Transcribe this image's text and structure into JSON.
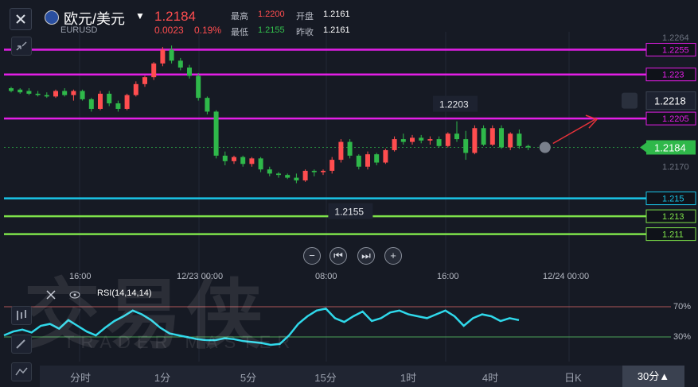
{
  "header": {
    "symbol_cn": "欧元/美元",
    "symbol_code": "EURUSD",
    "price": "1.2184",
    "change": "0.0023",
    "change_pct": "0.19%",
    "high_label": "最高",
    "high_value": "1.2200",
    "open_label": "开盘",
    "open_value": "1.2161",
    "low_label": "最低",
    "low_value": "1.2155",
    "prev_close_label": "昨收",
    "prev_close_value": "1.2161"
  },
  "price_axis": {
    "ticks": [
      {
        "text": "1.2264",
        "v": 1.2264
      },
      {
        "text": "1.2255",
        "v": 1.2255
      },
      {
        "text": "1.223",
        "v": 1.2237
      },
      {
        "text": "1.2218",
        "v": 1.2218
      },
      {
        "text": "1.2205",
        "v": 1.2205
      },
      {
        "text": "1.2184",
        "v": 1.2184
      },
      {
        "text": "1.2170",
        "v": 1.217
      },
      {
        "text": "1.215",
        "v": 1.2147
      },
      {
        "text": "1.213",
        "v": 1.2134
      },
      {
        "text": "1.211",
        "v": 1.2121
      }
    ]
  },
  "annotations": {
    "high_marker": "1.2203",
    "low_marker": "1.2155",
    "alert_price": "1.2218",
    "current_price": "1.2184"
  },
  "time_axis": [
    "16:00",
    "12/23 00:00",
    "08:00",
    "16:00",
    "12/24 00:00"
  ],
  "rsi": {
    "label": "RSI(14,14,14)",
    "level_high": "70%",
    "level_low": "30%"
  },
  "timeframes": [
    "分时",
    "1分",
    "5分",
    "15分",
    "1时",
    "4时",
    "日K",
    "30分▲"
  ],
  "watermark": {
    "cn": "交易侠",
    "en": "TRADER MASTER"
  },
  "colors": {
    "magenta": "#e31ee6",
    "cyan": "#19c4e6",
    "green": "#7ee24a",
    "up": "#ff4d4f",
    "down": "#2fb84a",
    "rsi": "#2fd8ea"
  },
  "chart_data": {
    "type": "candlestick",
    "title": "",
    "x": [
      "16:00",
      "12/23 00:00",
      "08:00",
      "16:00",
      "12/24 00:00"
    ],
    "ylim": [
      1.2115,
      1.2268
    ],
    "horizontal_lines": [
      {
        "value": 1.2255,
        "color": "magenta"
      },
      {
        "value": 1.2237,
        "color": "magenta"
      },
      {
        "value": 1.2205,
        "color": "magenta"
      },
      {
        "value": 1.2147,
        "color": "cyan"
      },
      {
        "value": 1.2134,
        "color": "green"
      },
      {
        "value": 1.2121,
        "color": "green"
      }
    ],
    "candles": [
      [
        1.2227,
        1.2228,
        1.2224,
        1.2225
      ],
      [
        1.2226,
        1.2227,
        1.2223,
        1.2224
      ],
      [
        1.2225,
        1.2227,
        1.2222,
        1.2223
      ],
      [
        1.2223,
        1.2225,
        1.2221,
        1.2222
      ],
      [
        1.2222,
        1.2224,
        1.222,
        1.2221
      ],
      [
        1.2221,
        1.2226,
        1.222,
        1.2225
      ],
      [
        1.2225,
        1.2227,
        1.2221,
        1.2222
      ],
      [
        1.2222,
        1.2226,
        1.2218,
        1.2225
      ],
      [
        1.2225,
        1.2226,
        1.2218,
        1.2219
      ],
      [
        1.2219,
        1.222,
        1.221,
        1.2212
      ],
      [
        1.2212,
        1.2225,
        1.2211,
        1.2223
      ],
      [
        1.2223,
        1.2225,
        1.2214,
        1.2216
      ],
      [
        1.2216,
        1.2218,
        1.221,
        1.2212
      ],
      [
        1.2212,
        1.2223,
        1.2211,
        1.2222
      ],
      [
        1.2222,
        1.2232,
        1.2221,
        1.223
      ],
      [
        1.223,
        1.2236,
        1.2228,
        1.2235
      ],
      [
        1.2235,
        1.2246,
        1.2233,
        1.2245
      ],
      [
        1.2245,
        1.2257,
        1.2243,
        1.2255
      ],
      [
        1.2255,
        1.2258,
        1.2245,
        1.2247
      ],
      [
        1.2247,
        1.2249,
        1.224,
        1.2242
      ],
      [
        1.2242,
        1.2244,
        1.2234,
        1.2236
      ],
      [
        1.2236,
        1.2238,
        1.2218,
        1.222
      ],
      [
        1.222,
        1.2221,
        1.2208,
        1.221
      ],
      [
        1.221,
        1.2211,
        1.2176,
        1.2178
      ],
      [
        1.2178,
        1.2181,
        1.2171,
        1.2174
      ],
      [
        1.2174,
        1.2178,
        1.2172,
        1.2177
      ],
      [
        1.2177,
        1.2178,
        1.217,
        1.2172
      ],
      [
        1.2172,
        1.2177,
        1.217,
        1.2176
      ],
      [
        1.2176,
        1.2177,
        1.2166,
        1.2168
      ],
      [
        1.2168,
        1.217,
        1.2163,
        1.2165
      ],
      [
        1.2165,
        1.2166,
        1.2162,
        1.2164
      ],
      [
        1.2164,
        1.2165,
        1.2161,
        1.2162
      ],
      [
        1.2162,
        1.2165,
        1.2158,
        1.216
      ],
      [
        1.216,
        1.2168,
        1.2159,
        1.2167
      ],
      [
        1.2167,
        1.2168,
        1.2163,
        1.2166
      ],
      [
        1.2166,
        1.2168,
        1.2164,
        1.2167
      ],
      [
        1.2167,
        1.2177,
        1.2165,
        1.2175
      ],
      [
        1.2175,
        1.219,
        1.2173,
        1.2188
      ],
      [
        1.2188,
        1.219,
        1.2176,
        1.2178
      ],
      [
        1.2178,
        1.2179,
        1.2168,
        1.217
      ],
      [
        1.217,
        1.2181,
        1.2168,
        1.2179
      ],
      [
        1.2179,
        1.218,
        1.2171,
        1.2173
      ],
      [
        1.2173,
        1.2183,
        1.2172,
        1.2182
      ],
      [
        1.2182,
        1.2192,
        1.2181,
        1.219
      ],
      [
        1.219,
        1.2194,
        1.2186,
        1.2188
      ],
      [
        1.2188,
        1.2193,
        1.2186,
        1.2191
      ],
      [
        1.2191,
        1.2193,
        1.2187,
        1.2189
      ],
      [
        1.2189,
        1.2192,
        1.2186,
        1.219
      ],
      [
        1.219,
        1.2192,
        1.2184,
        1.2185
      ],
      [
        1.2185,
        1.2195,
        1.2184,
        1.2194
      ],
      [
        1.2194,
        1.2203,
        1.2188,
        1.219
      ],
      [
        1.219,
        1.2196,
        1.2175,
        1.218
      ],
      [
        1.218,
        1.22,
        1.2179,
        1.2198
      ],
      [
        1.2198,
        1.22,
        1.2185,
        1.2186
      ],
      [
        1.2186,
        1.22,
        1.2185,
        1.2198
      ],
      [
        1.2198,
        1.22,
        1.2183,
        1.2184
      ],
      [
        1.2184,
        1.2195,
        1.2182,
        1.2194
      ],
      [
        1.2194,
        1.2197,
        1.2183,
        1.2185
      ],
      [
        1.2185,
        1.2186,
        1.2182,
        1.2184
      ]
    ],
    "rsi_values": [
      40,
      44,
      46,
      43,
      50,
      52,
      47,
      56,
      50,
      44,
      40,
      48,
      55,
      60,
      66,
      62,
      56,
      48,
      42,
      40,
      38,
      36,
      35,
      35,
      37,
      36,
      34,
      33,
      32,
      30,
      31,
      40,
      52,
      60,
      66,
      68,
      58,
      54,
      60,
      65,
      55,
      58,
      64,
      66,
      62,
      60,
      58,
      62,
      66,
      60,
      50,
      58,
      62,
      60,
      55,
      58,
      56
    ],
    "rsi_ylim": [
      0,
      100
    ]
  }
}
